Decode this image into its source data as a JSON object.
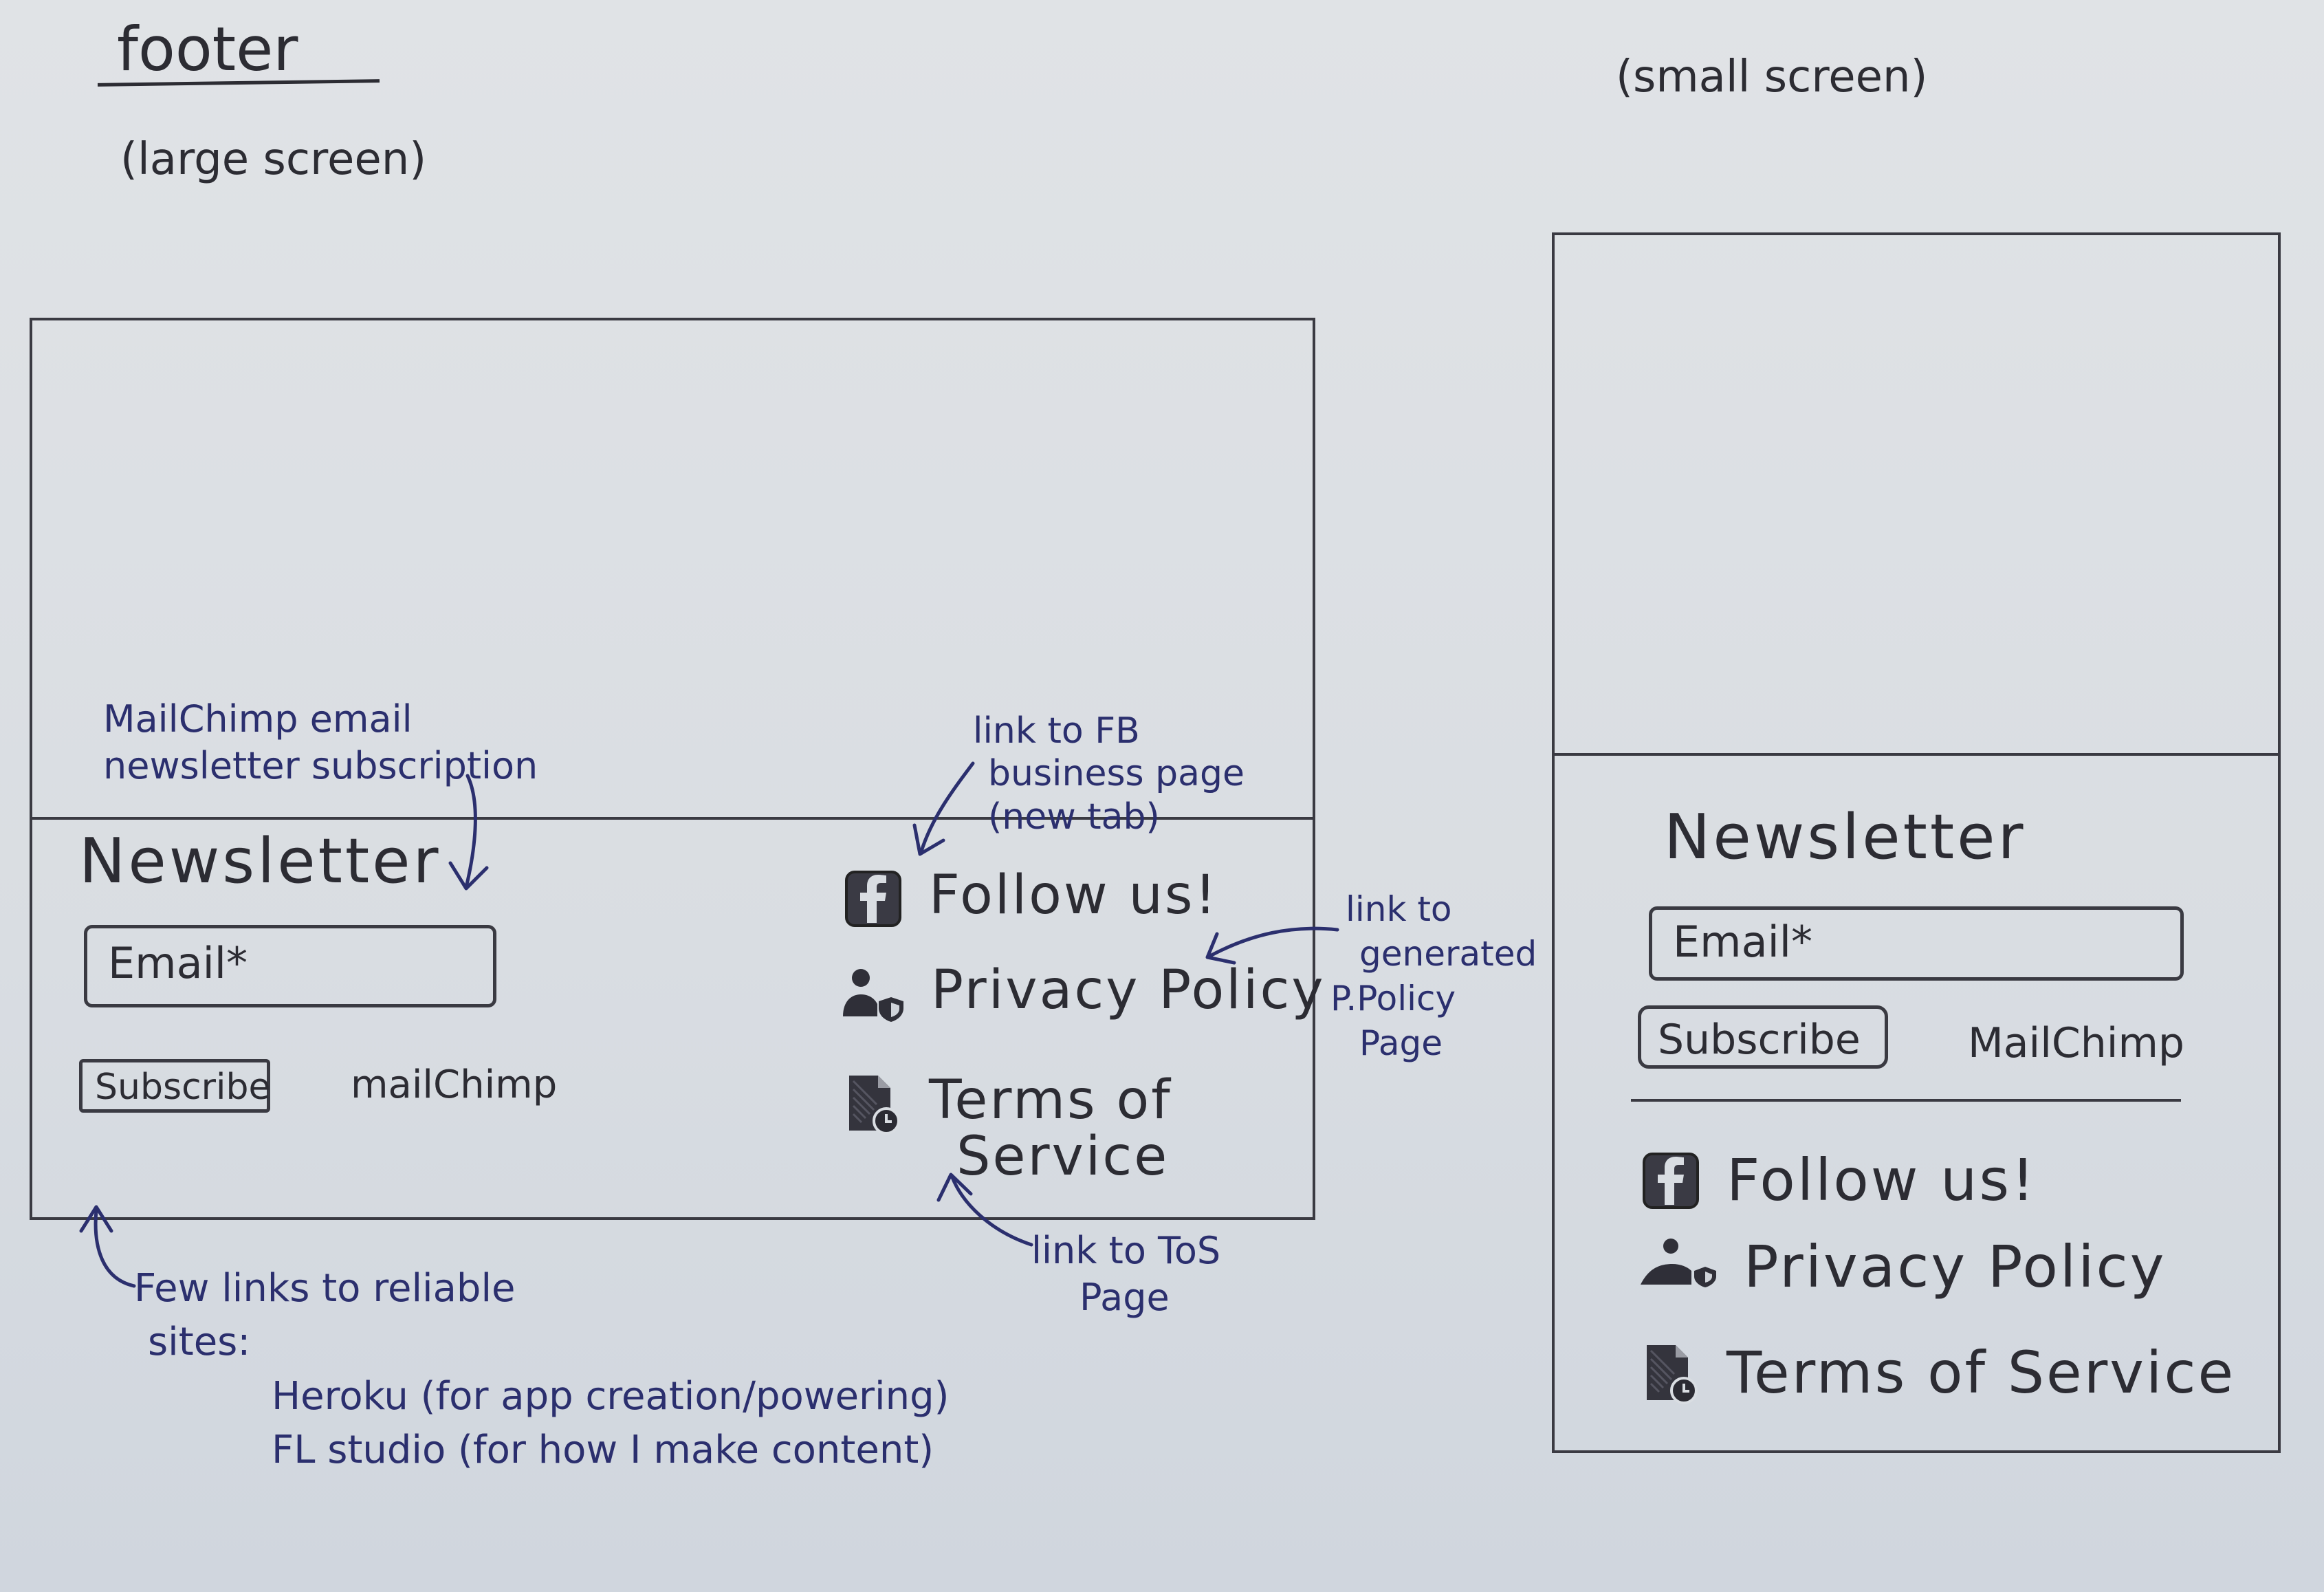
{
  "sheet": {
    "title": "footer",
    "large_label": "(large screen)",
    "small_label": "(small screen)"
  },
  "large_screen": {
    "newsletter_heading": "Newsletter",
    "email_placeholder": "Email*",
    "subscribe_label": "Subscribe",
    "mailchimp_label": "mailChimp",
    "links": {
      "follow": "Follow us!",
      "privacy": "Privacy Policy",
      "terms_line1": "Terms of",
      "terms_line2": "Service"
    }
  },
  "small_screen": {
    "newsletter_heading": "Newsletter",
    "email_placeholder": "Email*",
    "subscribe_label": "Subscribe",
    "mailchimp_label": "MailChimp",
    "links": {
      "follow": "Follow us!",
      "privacy": "Privacy Policy",
      "terms": "Terms of Service"
    }
  },
  "annotations": {
    "mailchimp_note_line1": "MailChimp email",
    "mailchimp_note_line2": "newsletter subscription",
    "fb_note_line1": "link to FB",
    "fb_note_line2": "business page",
    "fb_note_line3": "(new tab)",
    "privacy_note_line1": "link to",
    "privacy_note_line2": "generated",
    "privacy_note_line3": "P.Policy",
    "privacy_note_line4": "Page",
    "tos_note_line1": "link to ToS",
    "tos_note_line2": "Page",
    "sites_note_line1": "Few links to reliable",
    "sites_note_line2": "sites:",
    "sites_note_line3": "Heroku (for app creation/powering)",
    "sites_note_line4": "FL studio (for how I make content)"
  },
  "colors": {
    "ink": "#2c2c33",
    "annotation_ink": "#2b2f6e",
    "paper": "#dcdfe3"
  },
  "icons": [
    "facebook-icon",
    "privacy-user-shield-icon",
    "terms-document-clock-icon"
  ]
}
